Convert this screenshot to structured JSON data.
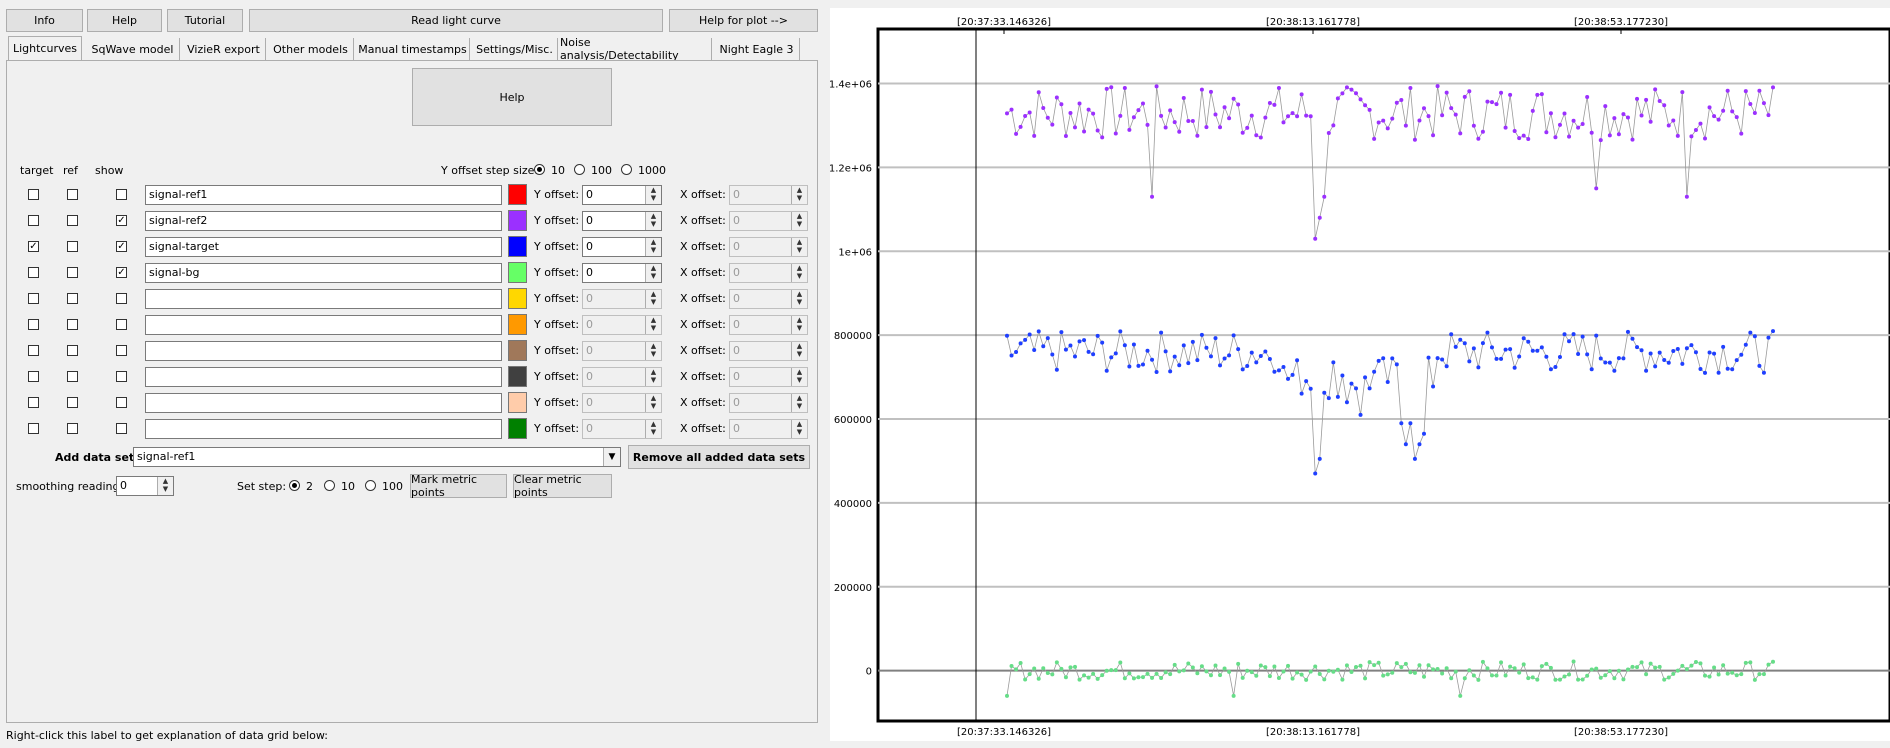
{
  "toolbar": {
    "info": "Info",
    "help": "Help",
    "tutorial": "Tutorial",
    "read": "Read light curve",
    "help_plot": "Help for plot -->"
  },
  "tabs": [
    "Lightcurves",
    "SqWave model",
    "VizieR export",
    "Other models",
    "Manual timestamps",
    "Settings/Misc.",
    "Noise analysis/Detectability",
    "Night Eagle 3"
  ],
  "panel": {
    "help_button": "Help",
    "col_target": "target",
    "col_ref": "ref",
    "col_show": "show",
    "yoffset_step_label": "Y offset step size:",
    "step_options": [
      "10",
      "100",
      "1000"
    ],
    "step_selected": "10",
    "y_offset_label": "Y offset:",
    "x_offset_label": "X offset:",
    "rows": [
      {
        "target": false,
        "ref": false,
        "show": false,
        "name": "signal-ref1",
        "color": "#ff0000",
        "y": "0",
        "x": "0",
        "enabled": true
      },
      {
        "target": false,
        "ref": false,
        "show": true,
        "name": "signal-ref2",
        "color": "#9b30ff",
        "y": "0",
        "x": "0",
        "enabled": true
      },
      {
        "target": true,
        "ref": false,
        "show": true,
        "name": "signal-target",
        "color": "#0000ff",
        "y": "0",
        "x": "0",
        "enabled": true
      },
      {
        "target": false,
        "ref": false,
        "show": true,
        "name": "signal-bg",
        "color": "#66ff66",
        "y": "0",
        "x": "0",
        "enabled": true
      },
      {
        "target": false,
        "ref": false,
        "show": false,
        "name": "",
        "color": "#ffd700",
        "y": "0",
        "x": "0",
        "enabled": false
      },
      {
        "target": false,
        "ref": false,
        "show": false,
        "name": "",
        "color": "#ff9900",
        "y": "0",
        "x": "0",
        "enabled": false
      },
      {
        "target": false,
        "ref": false,
        "show": false,
        "name": "",
        "color": "#a0785a",
        "y": "0",
        "x": "0",
        "enabled": false
      },
      {
        "target": false,
        "ref": false,
        "show": false,
        "name": "",
        "color": "#404040",
        "y": "0",
        "x": "0",
        "enabled": false
      },
      {
        "target": false,
        "ref": false,
        "show": false,
        "name": "",
        "color": "#ffccaa",
        "y": "0",
        "x": "0",
        "enabled": false
      },
      {
        "target": false,
        "ref": false,
        "show": false,
        "name": "",
        "color": "#008000",
        "y": "0",
        "x": "0",
        "enabled": false
      }
    ],
    "add_data_set_label": "Add data set",
    "add_data_set_value": "signal-ref1",
    "remove_all_button": "Remove all added data sets",
    "smoothing_label": "smoothing readings",
    "smoothing_value": "0",
    "set_step_label": "Set step:",
    "set_step_options": [
      "2",
      "10",
      "100"
    ],
    "set_step_selected": "2",
    "mark_button": "Mark metric points",
    "clear_button": "Clear metric points"
  },
  "status_label": "Right-click this label to get explanation of data grid below:",
  "chart_data": {
    "type": "scatter",
    "x_tick_labels": [
      "[20:37:33.146326]",
      "[20:38:13.161778]",
      "[20:38:53.177230]"
    ],
    "y_tick_labels": [
      "1.4e+06",
      "1.2e+06",
      "1e+06",
      "800000",
      "600000",
      "400000",
      "200000",
      "0"
    ],
    "y_ticks": [
      1400000,
      1200000,
      1000000,
      800000,
      600000,
      400000,
      200000,
      0
    ],
    "ylim": [
      -120000,
      1530000
    ],
    "x_points": 170,
    "series": [
      {
        "color": "#9b30ff",
        "base": 1330000,
        "noise": 65000,
        "dips": [
          [
            68,
            1030000
          ],
          [
            69,
            1080000
          ],
          [
            70,
            1130000
          ],
          [
            32,
            1130000
          ],
          [
            130,
            1150000
          ],
          [
            150,
            1130000
          ]
        ]
      },
      {
        "color": "#1f3fff",
        "base": 760000,
        "noise": 50000,
        "dips": [
          [
            68,
            470000
          ],
          [
            69,
            505000
          ],
          [
            88,
            540000
          ],
          [
            89,
            590000
          ],
          [
            90,
            505000
          ],
          [
            91,
            540000
          ],
          [
            92,
            565000
          ],
          [
            87,
            590000
          ],
          [
            75,
            640000
          ],
          [
            78,
            610000
          ],
          [
            71,
            650000
          ]
        ]
      },
      {
        "color": "#66dd88",
        "base": 0,
        "noise": 22000,
        "dips": [
          [
            0,
            -60000
          ],
          [
            50,
            -60000
          ],
          [
            100,
            -60000
          ]
        ]
      }
    ]
  }
}
